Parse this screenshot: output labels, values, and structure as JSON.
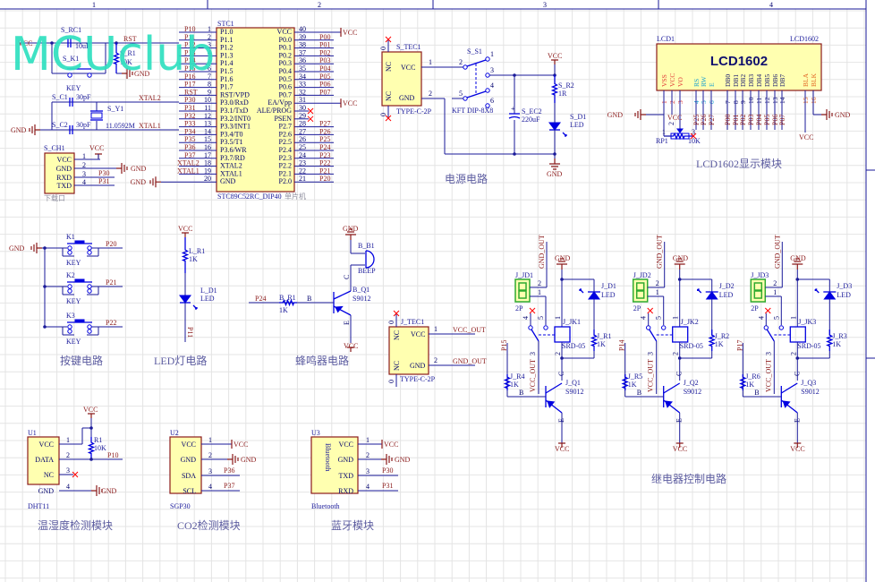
{
  "watermark": "MCUclub",
  "frame": {
    "columns": [
      "1",
      "2",
      "3",
      "4"
    ]
  },
  "colors": {
    "wire": "#1a1a9a",
    "component": "#0000e0",
    "net_label": "#8b1a1a",
    "part_fill": "#ffffb0",
    "watermark": "#2fe0c0",
    "title": "#5c5ca0"
  },
  "reset": {
    "vcc": "VCC",
    "cap_ref": "S_RC1",
    "cap_val": "10uF",
    "rst": "RST",
    "res_ref": "S_R1",
    "res_val": "10K",
    "key_ref": "S_K1",
    "key": "KEY",
    "gnd": "GND"
  },
  "crystal": {
    "c1_ref": "S_C1",
    "c1_val": "30pF",
    "c2_ref": "S_C2",
    "c2_val": "30pF",
    "y_ref": "S_Y1",
    "y_val": "11.0592M",
    "xtal2": "XTAL2",
    "xtal1": "XTAL1",
    "gnd": "GND"
  },
  "download": {
    "ref": "S_CH1",
    "pins": [
      "VCC",
      "GND",
      "RXD",
      "TXD"
    ],
    "nums": [
      "1",
      "2",
      "3",
      "4"
    ],
    "vcc": "VCC",
    "gnd": "GND",
    "nets": [
      "P30",
      "P31"
    ],
    "caption": "下载口"
  },
  "mcu": {
    "ref": "STC1",
    "part": "STC89C52RC_DIP40",
    "note": "单片机",
    "left_pins": [
      {
        "num": "1",
        "name": "P1.0",
        "net": "P10"
      },
      {
        "num": "2",
        "name": "P1.1",
        "net": "P11"
      },
      {
        "num": "3",
        "name": "P1.2",
        "net": "P12"
      },
      {
        "num": "4",
        "name": "P1.3",
        "net": "P13"
      },
      {
        "num": "5",
        "name": "P1.4",
        "net": "P14"
      },
      {
        "num": "6",
        "name": "P1.5",
        "net": "P15"
      },
      {
        "num": "7",
        "name": "P1.6",
        "net": "P16"
      },
      {
        "num": "8",
        "name": "P1.7",
        "net": "P17"
      },
      {
        "num": "9",
        "name": "RST/VPD",
        "net": "RST"
      },
      {
        "num": "10",
        "name": "P3.0/RxD",
        "net": "P30"
      },
      {
        "num": "11",
        "name": "P3.1/TxD",
        "net": "P31"
      },
      {
        "num": "12",
        "name": "P3.2/INT0",
        "net": "P32"
      },
      {
        "num": "13",
        "name": "P3.3/INT1",
        "net": "P33"
      },
      {
        "num": "14",
        "name": "P3.4/T0",
        "net": "P34"
      },
      {
        "num": "15",
        "name": "P3.5/T1",
        "net": "P35"
      },
      {
        "num": "16",
        "name": "P3.6/WR",
        "net": "P36"
      },
      {
        "num": "17",
        "name": "P3.7/RD",
        "net": "P37"
      },
      {
        "num": "18",
        "name": "XTAL2",
        "net": "XTAL2"
      },
      {
        "num": "19",
        "name": "XTAL1",
        "net": "XTAL1"
      },
      {
        "num": "20",
        "name": "GND",
        "net": "GND"
      }
    ],
    "right_pins": [
      {
        "num": "40",
        "name": "VCC",
        "net": "VCC"
      },
      {
        "num": "39",
        "name": "P0.0",
        "net": "P00"
      },
      {
        "num": "38",
        "name": "P0.1",
        "net": "P01"
      },
      {
        "num": "37",
        "name": "P0.2",
        "net": "P02"
      },
      {
        "num": "36",
        "name": "P0.3",
        "net": "P03"
      },
      {
        "num": "35",
        "name": "P0.4",
        "net": "P04"
      },
      {
        "num": "34",
        "name": "P0.5",
        "net": "P05"
      },
      {
        "num": "33",
        "name": "P0.6",
        "net": "P06"
      },
      {
        "num": "32",
        "name": "P0.7",
        "net": "P07"
      },
      {
        "num": "31",
        "name": "EA/Vpp",
        "net": "VCC"
      },
      {
        "num": "30",
        "name": "ALE/PROG",
        "net": ""
      },
      {
        "num": "29",
        "name": "PSEN",
        "net": ""
      },
      {
        "num": "28",
        "name": "P2.7",
        "net": "P27"
      },
      {
        "num": "27",
        "name": "P2.6",
        "net": "P26"
      },
      {
        "num": "26",
        "name": "P2.5",
        "net": "P25"
      },
      {
        "num": "25",
        "name": "P2.4",
        "net": "P24"
      },
      {
        "num": "24",
        "name": "P2.3",
        "net": "P23"
      },
      {
        "num": "23",
        "name": "P2.2",
        "net": "P22"
      },
      {
        "num": "22",
        "name": "P2.1",
        "net": "P21"
      },
      {
        "num": "21",
        "name": "P2.0",
        "net": "P20"
      }
    ]
  },
  "power": {
    "conn_ref": "S_TEC1",
    "conn_pins": [
      "VCC",
      "GND"
    ],
    "nc": "NC",
    "conn_nums": [
      "1",
      "2"
    ],
    "nc_num": "0",
    "conn_val": "TYPE-C-2P",
    "sw_ref": "S_S1",
    "sw_val": "KFT DIP-8X8",
    "sw_pins": [
      "1",
      "2",
      "3",
      "4",
      "5",
      "6"
    ],
    "cap_ref": "S_EC2",
    "cap_val": "220uF",
    "cap_plus": "+",
    "vcc": "VCC",
    "r_ref": "S_R2",
    "r_val": "1R",
    "led_ref": "S_D1",
    "led_val": "LED",
    "gnd": "GND",
    "title": "电源电路"
  },
  "lcd": {
    "ref": "LCD1",
    "part": "LCD1602",
    "label": "LCD1602",
    "pins": [
      {
        "name": "VSS",
        "num": "1",
        "net": ""
      },
      {
        "name": "VCC",
        "num": "2",
        "net": ""
      },
      {
        "name": "VO",
        "num": "3",
        "net": ""
      },
      {
        "name": "RS",
        "num": "4",
        "net": "P25"
      },
      {
        "name": "RW",
        "num": "5",
        "net": "P26"
      },
      {
        "name": "E",
        "num": "6",
        "net": "P27"
      },
      {
        "name": "DB0",
        "num": "7",
        "net": "P00"
      },
      {
        "name": "DB1",
        "num": "8",
        "net": "P01"
      },
      {
        "name": "DB2",
        "num": "9",
        "net": "P02"
      },
      {
        "name": "DB3",
        "num": "10",
        "net": "P03"
      },
      {
        "name": "DB4",
        "num": "11",
        "net": "P04"
      },
      {
        "name": "DB5",
        "num": "12",
        "net": "P05"
      },
      {
        "name": "DB6",
        "num": "13",
        "net": "P06"
      },
      {
        "name": "DB7",
        "num": "14",
        "net": "P07"
      },
      {
        "name": "BLA",
        "num": "15",
        "net": ""
      },
      {
        "name": "BLK",
        "num": "16",
        "net": ""
      }
    ],
    "gnd_left": "GND",
    "vcc_mid": "VCC",
    "vcc_bl": "VCC",
    "gnd_right": "GND",
    "pot_ref": "RP1",
    "pot_val": "10K",
    "pot_nums": [
      "1",
      "2",
      "3"
    ],
    "title": "LCD1602显示模块"
  },
  "keys": {
    "gnd": "GND",
    "items": [
      {
        "ref": "K1",
        "val": "KEY",
        "net": "P20"
      },
      {
        "ref": "K2",
        "val": "KEY",
        "net": "P21"
      },
      {
        "ref": "K3",
        "val": "KEY",
        "net": "P22"
      }
    ],
    "title": "按键电路"
  },
  "led": {
    "vcc": "VCC",
    "r_ref": "L_R1",
    "r_val": "1K",
    "d_ref": "L_D1",
    "d_val": "LED",
    "net": "P11",
    "title": "LED灯电路"
  },
  "buzzer": {
    "gnd": "GND",
    "b_ref": "B_B1",
    "b_val": "BEEP",
    "q_ref": "B_Q1",
    "q_val": "S9012",
    "net": "P24",
    "r_ref": "B_R1",
    "r_val": "1K",
    "b": "B",
    "c": "C",
    "e": "E",
    "vcc": "VCC",
    "title": "蜂鸣器电路"
  },
  "typec_out": {
    "ref": "J_TEC1",
    "pins": [
      "VCC",
      "GND"
    ],
    "nc": "NC",
    "nums": [
      "1",
      "2"
    ],
    "nc_num": "0",
    "val": "TYPE-C-2P",
    "nets": [
      "VCC_OUT",
      "GND_OUT"
    ]
  },
  "relays": [
    {
      "conn_ref": "J_JD1",
      "conn_val": "2P",
      "conn_pins": [
        "2",
        "1"
      ],
      "gnd_out": "GND_OUT",
      "gnd": "GND",
      "led_ref": "J_D1",
      "led_val": "LED",
      "relay_ref": "J_JK1",
      "relay_val": "SRD-05",
      "relay_pins": [
        "1",
        "2",
        "3",
        "4",
        "5"
      ],
      "r_ref": "J_R1",
      "r_val": "1K",
      "input": "P15",
      "rb_ref": "J_R4",
      "rb_val": "1K",
      "vcc_out": "VCC_OUT",
      "q_ref": "J_Q1",
      "q_val": "S9012",
      "b": "B",
      "c": "C",
      "e": "E",
      "vcc": "VCC"
    },
    {
      "conn_ref": "J_JD2",
      "conn_val": "2P",
      "conn_pins": [
        "2",
        "1"
      ],
      "gnd_out": "GND_OUT",
      "gnd": "GND",
      "led_ref": "J_D2",
      "led_val": "LED",
      "relay_ref": "J_JK2",
      "relay_val": "SRD-05",
      "relay_pins": [
        "1",
        "2",
        "3",
        "4",
        "5"
      ],
      "r_ref": "J_R2",
      "r_val": "1K",
      "input": "P14",
      "rb_ref": "J_R5",
      "rb_val": "1K",
      "vcc_out": "VCC_OUT",
      "q_ref": "J_Q2",
      "q_val": "S9012",
      "b": "B",
      "c": "C",
      "e": "E",
      "vcc": "VCC"
    },
    {
      "conn_ref": "J_JD3",
      "conn_val": "2P",
      "conn_pins": [
        "2",
        "1"
      ],
      "gnd_out": "GND_OUT",
      "gnd": "GND",
      "led_ref": "J_D3",
      "led_val": "LED",
      "relay_ref": "J_JK3",
      "relay_val": "SRD-05",
      "relay_pins": [
        "1",
        "2",
        "3",
        "4",
        "5"
      ],
      "r_ref": "J_R3",
      "r_val": "1K",
      "input": "P17",
      "rb_ref": "J_R6",
      "rb_val": "1K",
      "vcc_out": "VCC_OUT",
      "q_ref": "J_Q3",
      "q_val": "S9012",
      "b": "B",
      "c": "C",
      "e": "E",
      "vcc": "VCC"
    }
  ],
  "relay_title": "继电器控制电路",
  "dht11": {
    "ref": "U1",
    "val": "DHT11",
    "pins": [
      "VCC",
      "DATA",
      "NC",
      "GND"
    ],
    "nums": [
      "1",
      "2",
      "3",
      "4"
    ],
    "vcc": "VCC",
    "r_ref": "R1",
    "r_val": "10K",
    "net": "P10",
    "gnd": "GND",
    "title": "温湿度检测模块"
  },
  "sgp30": {
    "ref": "U2",
    "val": "SGP30",
    "pins": [
      "VCC",
      "GND",
      "SDA",
      "SCL"
    ],
    "nums": [
      "1",
      "2",
      "3",
      "4"
    ],
    "vcc": "VCC",
    "gnd": "GND",
    "nets": [
      "P36",
      "P37"
    ],
    "title": "CO2检测模块"
  },
  "bluetooth": {
    "ref": "U3",
    "val": "Bluetooth",
    "inner": "Bluetooth",
    "pins": [
      "VCC",
      "GND",
      "TXD",
      "RXD"
    ],
    "nums": [
      "1",
      "2",
      "3",
      "4"
    ],
    "vcc": "VCC",
    "gnd": "GND",
    "nets": [
      "P30",
      "P31"
    ],
    "title": "蓝牙模块"
  }
}
